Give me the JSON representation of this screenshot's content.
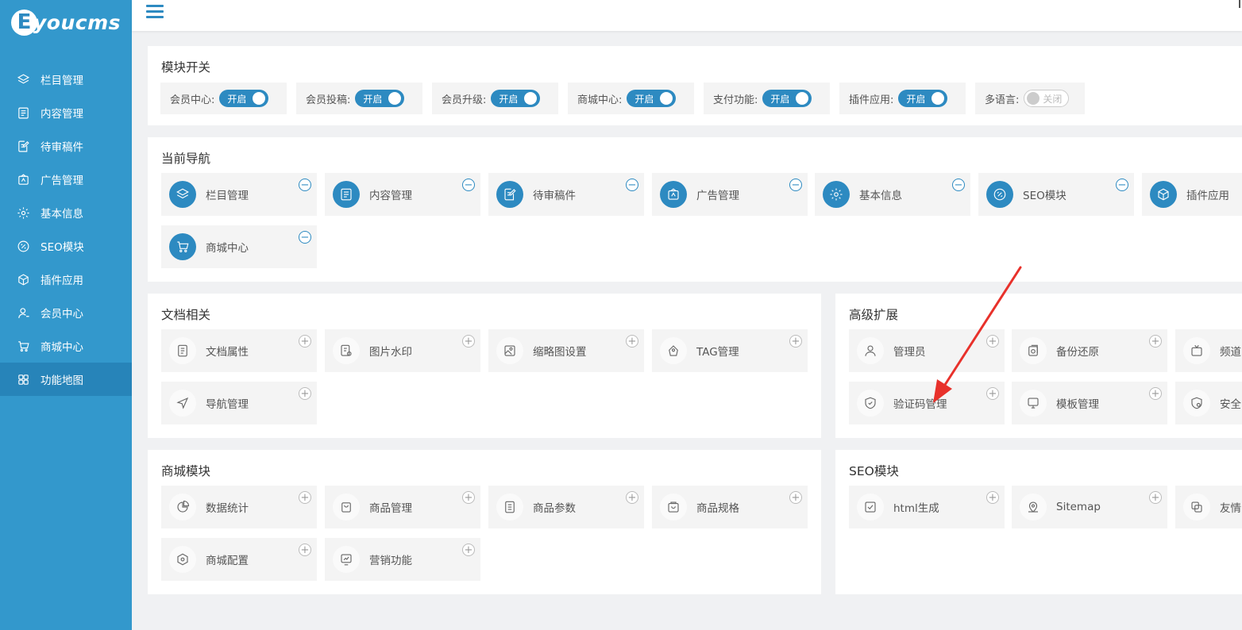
{
  "brand": {
    "logo_letter": "E",
    "logo_text": "youcms"
  },
  "sidebar": {
    "items": [
      {
        "label": "栏目管理",
        "icon": "layers-icon"
      },
      {
        "label": "内容管理",
        "icon": "document-icon"
      },
      {
        "label": "待审稿件",
        "icon": "edit-doc-icon"
      },
      {
        "label": "广告管理",
        "icon": "ad-icon"
      },
      {
        "label": "基本信息",
        "icon": "gear-icon"
      },
      {
        "label": "SEO模块",
        "icon": "link-icon"
      },
      {
        "label": "插件应用",
        "icon": "cube-icon"
      },
      {
        "label": "会员中心",
        "icon": "user-icon"
      },
      {
        "label": "商城中心",
        "icon": "cart-icon"
      },
      {
        "label": "功能地图",
        "icon": "grid-icon",
        "active": true
      }
    ]
  },
  "modules": {
    "title": "模块开关",
    "switches": [
      {
        "label": "会员中心:",
        "state": "开启"
      },
      {
        "label": "会员投稿:",
        "state": "开启"
      },
      {
        "label": "会员升级:",
        "state": "开启"
      },
      {
        "label": "商城中心:",
        "state": "开启"
      },
      {
        "label": "支付功能:",
        "state": "开启"
      },
      {
        "label": "插件应用:",
        "state": "开启"
      },
      {
        "label": "多语言:",
        "state": "关闭"
      }
    ]
  },
  "current_nav": {
    "title": "当前导航",
    "items": [
      {
        "label": "栏目管理",
        "icon": "layers-icon"
      },
      {
        "label": "内容管理",
        "icon": "document-icon"
      },
      {
        "label": "待审稿件",
        "icon": "edit-doc-icon"
      },
      {
        "label": "广告管理",
        "icon": "ad-icon"
      },
      {
        "label": "基本信息",
        "icon": "gear-icon"
      },
      {
        "label": "SEO模块",
        "icon": "link-icon"
      },
      {
        "label": "插件应用",
        "icon": "cube-icon"
      },
      {
        "label": "商城中心",
        "icon": "cart-icon"
      }
    ]
  },
  "doc_related": {
    "title": "文档相关",
    "items": [
      {
        "label": "文档属性",
        "icon": "list-doc-icon"
      },
      {
        "label": "图片水印",
        "icon": "watermark-icon"
      },
      {
        "label": "缩略图设置",
        "icon": "image-icon"
      },
      {
        "label": "TAG管理",
        "icon": "tag-icon"
      },
      {
        "label": "导航管理",
        "icon": "navigation-icon"
      }
    ]
  },
  "advanced": {
    "title": "高级扩展",
    "items": [
      {
        "label": "管理员",
        "icon": "person-icon"
      },
      {
        "label": "备份还原",
        "icon": "backup-icon"
      },
      {
        "label": "频道",
        "icon": "tv-icon"
      },
      {
        "label": "验证码管理",
        "icon": "shield-check-icon"
      },
      {
        "label": "模板管理",
        "icon": "monitor-icon"
      },
      {
        "label": "安全",
        "icon": "security-icon"
      }
    ]
  },
  "shop_module": {
    "title": "商城模块",
    "items": [
      {
        "label": "数据统计",
        "icon": "pie-chart-icon"
      },
      {
        "label": "商品管理",
        "icon": "bag-icon"
      },
      {
        "label": "商品参数",
        "icon": "list-icon"
      },
      {
        "label": "商品规格",
        "icon": "box-icon"
      },
      {
        "label": "商城配置",
        "icon": "hexagon-icon"
      },
      {
        "label": "营销功能",
        "icon": "trend-icon"
      }
    ]
  },
  "seo_module": {
    "title": "SEO模块",
    "items": [
      {
        "label": "html生成",
        "icon": "check-square-icon"
      },
      {
        "label": "Sitemap",
        "icon": "map-pin-icon"
      },
      {
        "label": "友情",
        "icon": "copy-icon"
      }
    ]
  },
  "colors": {
    "sidebar": "#3398cc",
    "accent": "#2d8ac1",
    "arrow": "#e8312b"
  }
}
